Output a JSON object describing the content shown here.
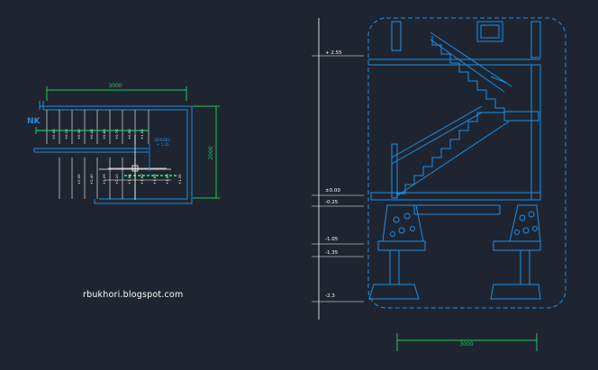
{
  "watermark": "rbukhori.blogspot.com",
  "plan": {
    "north_label": "NK",
    "width_dim": "3000",
    "depth_dim": "2000",
    "bordes_label": "BORDES",
    "bordes_level": "+ 1.20",
    "upper_levels": [
      "+0.00",
      "+0.15",
      "+0.30",
      "+0.45",
      "+0.60",
      "+0.75",
      "+0.90",
      "+1.05"
    ],
    "lower_levels": [
      "+2.55",
      "+2.40",
      "+2.25",
      "+2.10",
      "+1.95",
      "+1.80",
      "+1.65",
      "+1.50",
      "+1.35"
    ]
  },
  "section": {
    "width_dim": "3000",
    "levels": [
      "+ 2.55",
      "±0.00",
      "-0.25",
      "-1.05",
      "-1.35",
      "-2.3"
    ]
  },
  "colors": {
    "background": "#1f2530",
    "blue": "#1e8fe8",
    "green": "#22c55e",
    "white": "#ffffff",
    "yellow": "#e8e84a"
  }
}
